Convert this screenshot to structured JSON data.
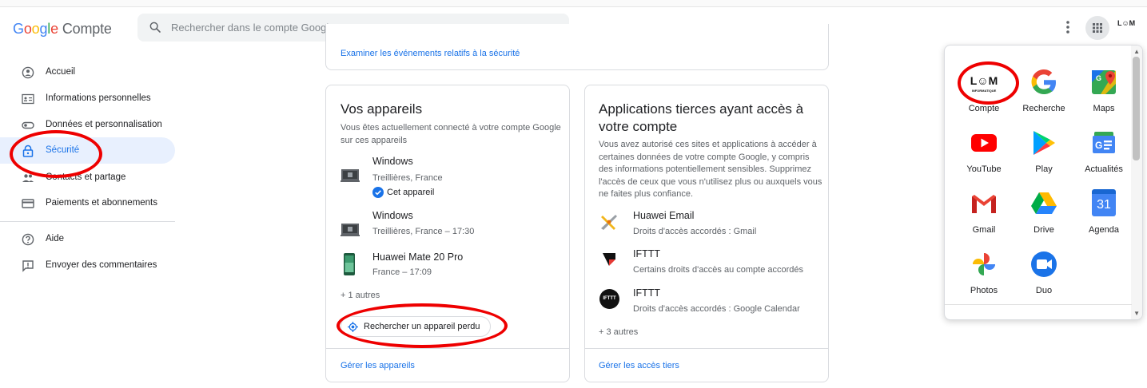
{
  "header": {
    "logo_google": "Google",
    "logo_product": "Compte",
    "search_placeholder": "Rechercher dans le compte Google",
    "avatar_text": "L☺M"
  },
  "sidebar": {
    "items": [
      {
        "label": "Accueil",
        "icon": "account-circle-icon"
      },
      {
        "label": "Informations personnelles",
        "icon": "id-card-icon"
      },
      {
        "label": "Données et personnalisation",
        "icon": "toggle-icon"
      },
      {
        "label": "Sécurité",
        "icon": "lock-icon",
        "active": true
      },
      {
        "label": "Contacts et partage",
        "icon": "people-icon"
      },
      {
        "label": "Paiements et abonnements",
        "icon": "credit-card-icon"
      },
      {
        "label": "Aide",
        "icon": "help-icon"
      },
      {
        "label": "Envoyer des commentaires",
        "icon": "feedback-icon"
      }
    ]
  },
  "security_events": {
    "link": "Examiner les événements relatifs à la sécurité"
  },
  "devices_card": {
    "title": "Vos appareils",
    "description": "Vous êtes actuellement connecté à votre compte Google sur ces appareils",
    "devices": [
      {
        "name": "Windows",
        "location": "Treillières, France",
        "badge": "Cet appareil",
        "icon": "laptop-icon"
      },
      {
        "name": "Windows",
        "location": "Treillières, France – 17:30",
        "icon": "laptop-icon"
      },
      {
        "name": "Huawei Mate 20 Pro",
        "location": "France – 17:09",
        "icon": "phone-icon"
      }
    ],
    "more": "+ 1 autres",
    "find_device": "Rechercher un appareil perdu",
    "footer_link": "Gérer les appareils"
  },
  "apps_card": {
    "title": "Applications tierces ayant accès à votre compte",
    "description": "Vous avez autorisé ces sites et applications à accéder à certaines données de votre compte Google, y compris des informations potentiellement sensibles. Supprimez l'accès de ceux que vous n'utilisez plus ou auxquels vous ne faites plus confiance.",
    "apps": [
      {
        "name": "Huawei Email",
        "access": "Droits d'accès accordés : Gmail",
        "icon": "huawei-email-icon"
      },
      {
        "name": "IFTTT",
        "access": "Certains droits d'accès au compte accordés",
        "icon": "ifttt-flag-icon"
      },
      {
        "name": "IFTTT",
        "access": "Droits d'accès accordés : Google Calendar",
        "icon": "ifttt-logo-icon",
        "icon_text": "IFTTT"
      }
    ],
    "more": "+ 3 autres",
    "footer_link": "Gérer les accès tiers"
  },
  "apps_launcher": {
    "tiles": [
      {
        "label": "Compte",
        "icon": "compte-logo-icon",
        "icon_text": "L☺M",
        "icon_subtext": "INFORMATIQUE"
      },
      {
        "label": "Recherche",
        "icon": "google-g-icon"
      },
      {
        "label": "Maps",
        "icon": "maps-icon"
      },
      {
        "label": "YouTube",
        "icon": "youtube-icon"
      },
      {
        "label": "Play",
        "icon": "play-icon"
      },
      {
        "label": "Actualités",
        "icon": "news-icon"
      },
      {
        "label": "Gmail",
        "icon": "gmail-icon"
      },
      {
        "label": "Drive",
        "icon": "drive-icon"
      },
      {
        "label": "Agenda",
        "icon": "calendar-icon",
        "icon_text": "31"
      },
      {
        "label": "Photos",
        "icon": "photos-icon"
      },
      {
        "label": "Duo",
        "icon": "duo-icon"
      }
    ]
  },
  "colors": {
    "google_blue": "#1a73e8",
    "annotation_red": "#e00000",
    "active_nav_bg": "#e8f0fe"
  }
}
